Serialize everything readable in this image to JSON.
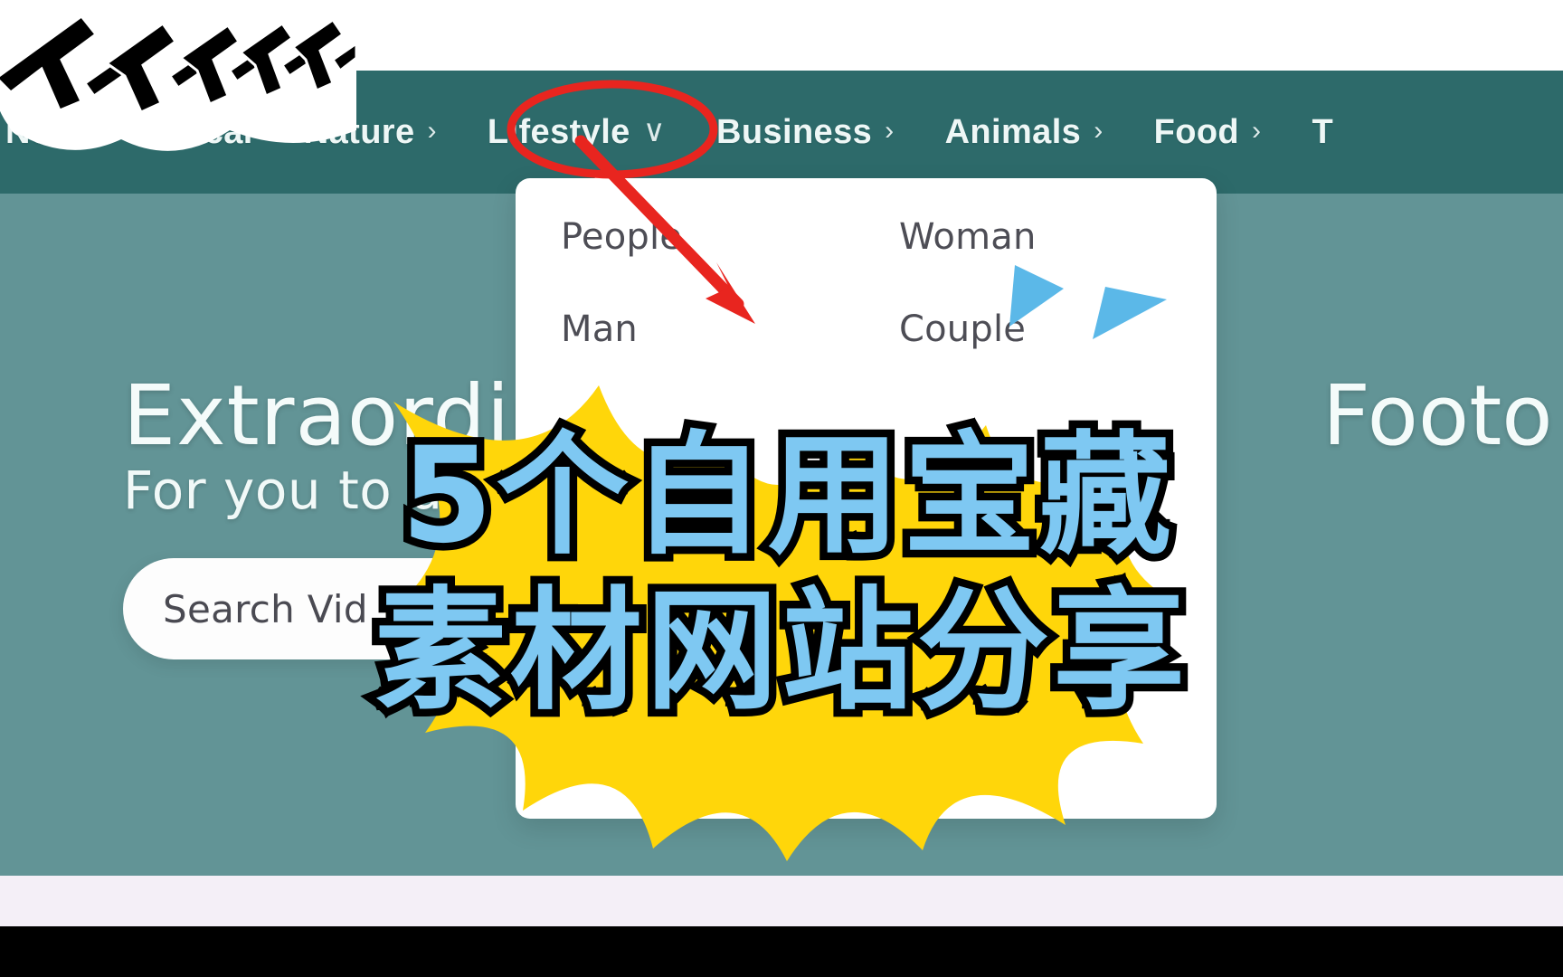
{
  "site": {
    "nav": {
      "items": [
        {
          "label": "New",
          "icon": "",
          "state": "truncated-left"
        },
        {
          "label": "Vertical",
          "icon": "",
          "state": "default"
        },
        {
          "label": "Nature",
          "icon": "chevron-right-icon",
          "state": "default"
        },
        {
          "label": "Lifestyle",
          "icon": "chevron-down-icon",
          "state": "open"
        },
        {
          "label": "Business",
          "icon": "chevron-right-icon",
          "state": "default"
        },
        {
          "label": "Animals",
          "icon": "chevron-right-icon",
          "state": "default"
        },
        {
          "label": "Food",
          "icon": "chevron-right-icon",
          "state": "default"
        },
        {
          "label": "T",
          "icon": "",
          "state": "truncated-right"
        }
      ],
      "chevron_right_glyph": "›",
      "chevron_down_glyph": "∨"
    },
    "dropdown": {
      "open_for": "Lifestyle",
      "column_left": [
        "People",
        "Man"
      ],
      "column_right": [
        "Woman",
        "Couple"
      ]
    },
    "hero": {
      "title": "Extraordin",
      "title_right": "Footo",
      "subtitle": "For you to us",
      "search_placeholder": "Search Vid"
    }
  },
  "overlay": {
    "headline_line1": "5个自用宝藏",
    "headline_line2": "素材网站分享",
    "watermark_text": "不一不一不一不一一"
  },
  "colors": {
    "nav_bar": "#2d6a6a",
    "hero_bg": "#629496",
    "dropdown_bg": "#ffffff",
    "annotation_red": "#e8251f",
    "burst_yellow": "#ffd60a",
    "spark_blue": "#5bb8e8",
    "headline_fill": "#7ec8f2",
    "headline_stroke": "#000000",
    "bottom_strip": "#f4eff7",
    "letterbox": "#000000"
  }
}
